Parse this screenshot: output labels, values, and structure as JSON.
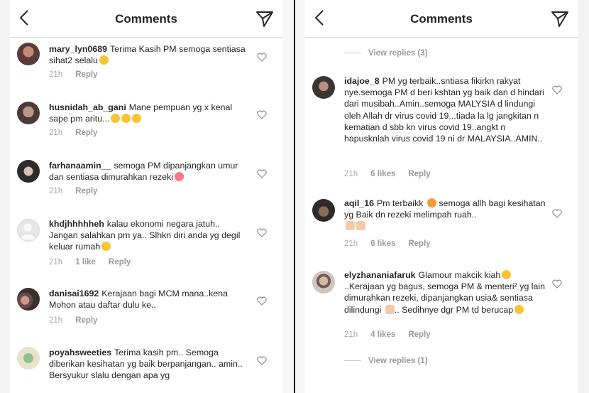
{
  "left": {
    "title": "Comments",
    "comments": [
      {
        "user": "mary_lyn0689",
        "text": "Terima Kasih PM semoga sentiasa sihat2 selalu",
        "time": "21h",
        "likes": "",
        "reply": "Reply"
      },
      {
        "user": "husnidah_ab_gani",
        "text": "Mane pempuan yg x kenal sape pm aritu...",
        "time": "21h",
        "likes": "",
        "reply": "Reply"
      },
      {
        "user": "farhanaamin__",
        "text": "semoga PM dipanjangkan umur dan sentiasa dimurahkan rezeki",
        "time": "21h",
        "likes": "",
        "reply": "Reply"
      },
      {
        "user": "khdjhhhhheh",
        "text": "kalau ekonomi negara jatuh.. Jangan salahkan pm ya.. Slhkn diri anda yg degil keluar rumah",
        "time": "21h",
        "likes": "1 like",
        "reply": "Reply"
      },
      {
        "user": "danisai1692",
        "text": "Kerajaan bagi MCM mana..kena Mohon atau daftar dulu ke..",
        "time": "21h",
        "likes": "",
        "reply": "Reply"
      },
      {
        "user": "poyahsweeties",
        "text": "Terima kasih pm.. Semoga diberikan kesihatan yg baik berpanjangan.. amin.. Bersyukur slalu dengan apa yg",
        "time": "",
        "likes": "",
        "reply": ""
      }
    ]
  },
  "right": {
    "title": "Comments",
    "view_replies_top": "View replies (3)",
    "view_replies_bottom": "View replies (1)",
    "comments": [
      {
        "user": "idajoe_8",
        "text": "PM yg terbaik..sntiasa fikirkn rakyat nye.semoga PM d beri kshtan yg baik dan d hindari dari musibah..Amin..semoga MALYSIA d lindungi oleh Allah dr virus covid 19...tiada la lg jangkitan n kematian d sbb kn virus covid 19..angkt n hapusknlah virus covid 19 ni dr MALAYSIA..AMIN..",
        "time": "21h",
        "likes": "6 likes",
        "reply": "Reply"
      },
      {
        "user": "aqil_16",
        "text": "Pm terbaikk",
        "text2": "semoga allh bagi kesihatan yg Baik dn rezeki melimpah ruah..",
        "time": "21h",
        "likes": "6 likes",
        "reply": "Reply"
      },
      {
        "user": "elyzhananiafaruk",
        "text": "Glamour makcik kiah",
        "text2": "..Kerajaan yg bagus, semoga PM & menteri² yg lain dimurahkan rezeki, dipanjangkan usia& sentiasa dilindungi",
        "text3": ".. Sedihnye dgr PM td berucap",
        "time": "21h",
        "likes": "4 likes",
        "reply": "Reply"
      }
    ]
  },
  "icons": {
    "back": "chevron-left-icon",
    "send": "paper-plane-icon",
    "like": "heart-outline-icon"
  },
  "colors": {
    "text": "#262626",
    "meta": "#9a9a9a",
    "divider": "#dbdbdb"
  }
}
